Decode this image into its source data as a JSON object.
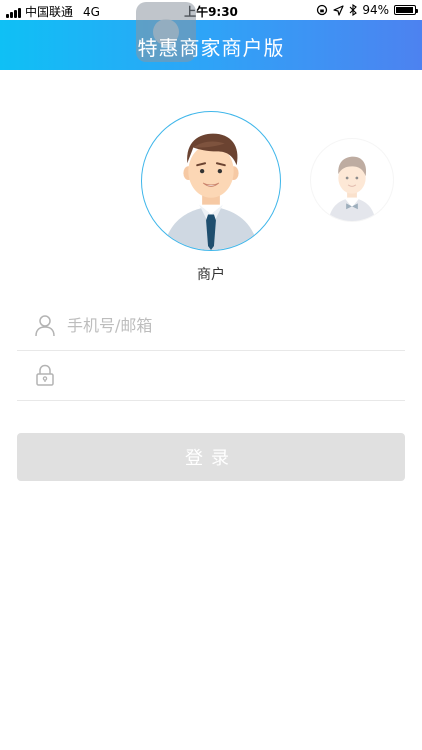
{
  "status_bar": {
    "carrier": "中国联通",
    "network": "4G",
    "time": "上午9:30",
    "battery_percent": "94%"
  },
  "header": {
    "title": "特惠商家商户版"
  },
  "account_type": {
    "selected_label": "商户",
    "options": [
      "merchant",
      "waiter"
    ]
  },
  "form": {
    "username_placeholder": "手机号/邮箱",
    "username_value": "",
    "password_placeholder": "",
    "password_value": "",
    "login_label": "登录"
  },
  "colors": {
    "header_gradient_start": "#0fc0f5",
    "header_gradient_end": "#4d82f0",
    "avatar_ring": "#3fb6ea",
    "button_disabled_bg": "#e0e0e0"
  },
  "icons": [
    "signal-icon",
    "location-icon",
    "bluetooth-icon",
    "battery-icon",
    "user-icon",
    "lock-icon"
  ]
}
